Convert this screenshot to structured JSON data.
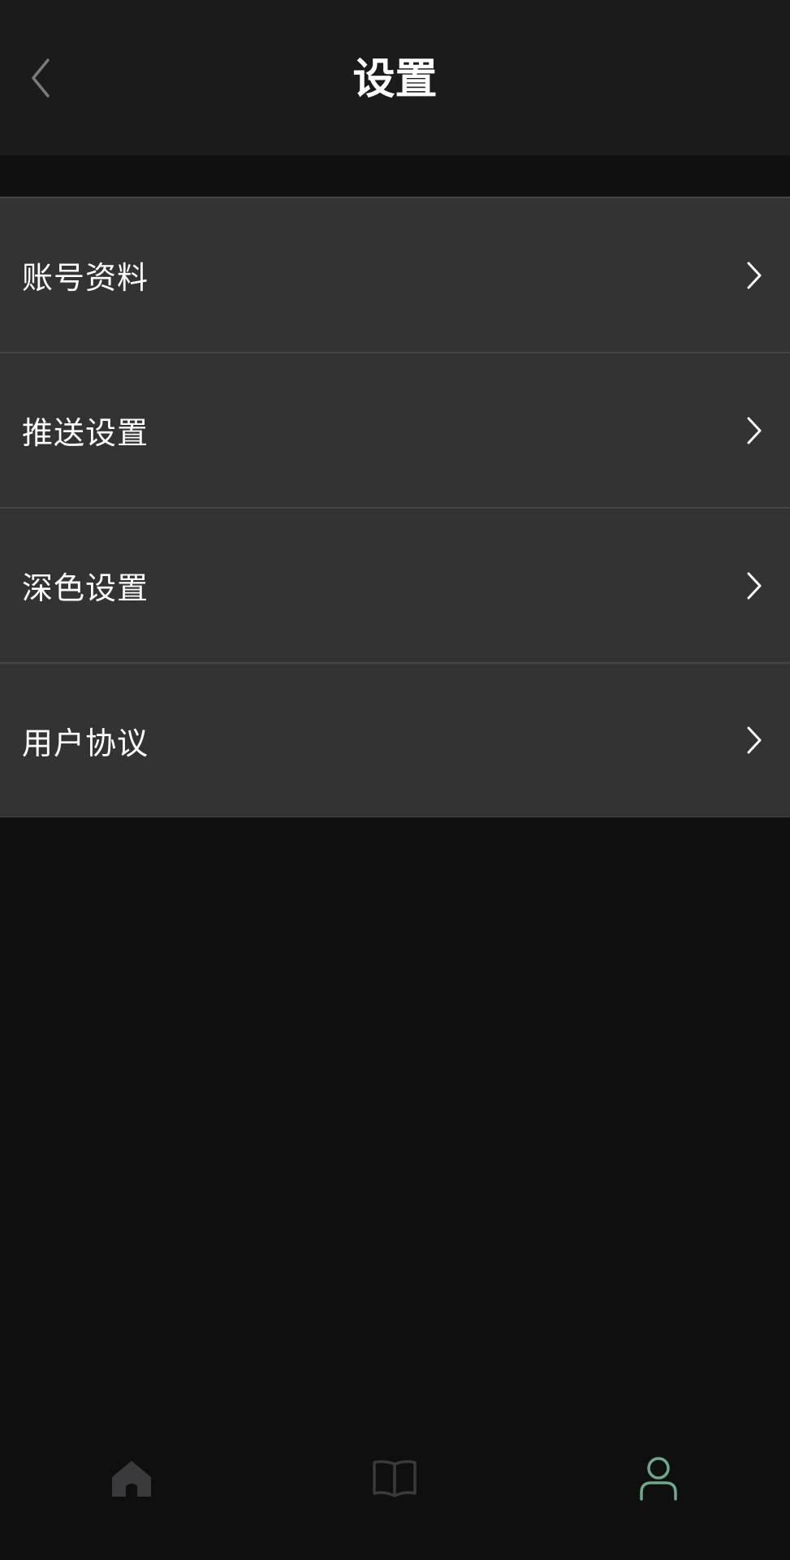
{
  "header": {
    "title": "设置",
    "back_icon": "chevron-left-icon"
  },
  "settings": {
    "items": [
      {
        "label": "账号资料",
        "icon": "chevron-right-icon"
      },
      {
        "label": "推送设置",
        "icon": "chevron-right-icon"
      },
      {
        "label": "深色设置",
        "icon": "chevron-right-icon"
      },
      {
        "label": "用户协议",
        "icon": "chevron-right-icon"
      }
    ]
  },
  "tabbar": {
    "tabs": [
      {
        "icon": "home-icon",
        "active": false
      },
      {
        "icon": "book-icon",
        "active": false
      },
      {
        "icon": "user-icon",
        "active": true
      }
    ]
  },
  "colors": {
    "header_bg": "#1b1b1b",
    "page_bg": "#0f0f0f",
    "item_bg": "#333333",
    "divider": "#454545",
    "text": "#ffffff",
    "tab_inactive": "#3a3a3d",
    "tab_active": "#6fa88a"
  }
}
